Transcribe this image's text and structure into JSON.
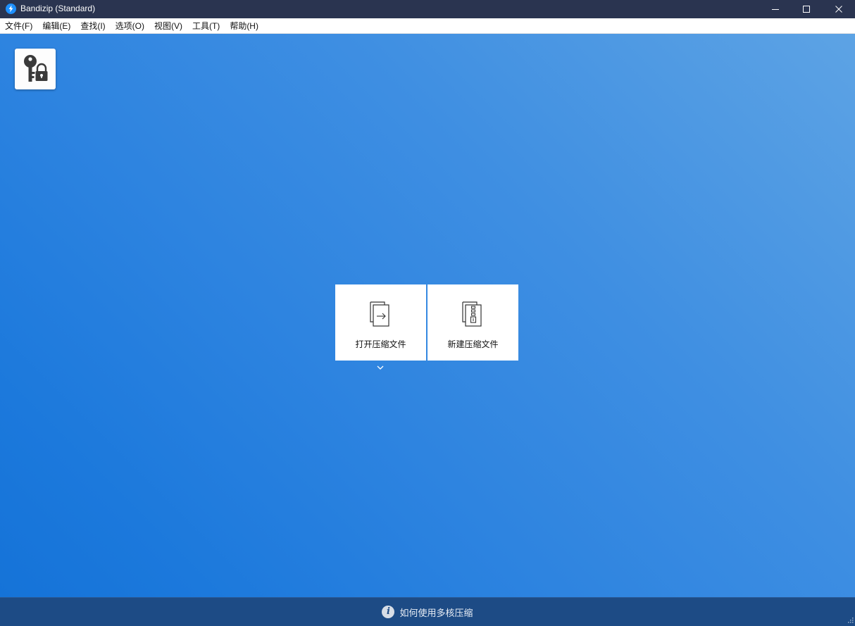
{
  "window": {
    "title": "Bandizip (Standard)"
  },
  "menu": {
    "items": [
      "文件(F)",
      "编辑(E)",
      "查找(I)",
      "选项(O)",
      "视图(V)",
      "工具(T)",
      "帮助(H)"
    ]
  },
  "toolbar": {
    "password_tool_icon": "key-lock-icon"
  },
  "actions": {
    "open_archive_label": "打开压缩文件",
    "new_archive_label": "新建压缩文件"
  },
  "statusbar": {
    "text": "如何使用多核压缩"
  },
  "colors": {
    "titlebar": "#2a3450",
    "accent": "#1e90ff",
    "statusbar": "#1d4b85"
  }
}
